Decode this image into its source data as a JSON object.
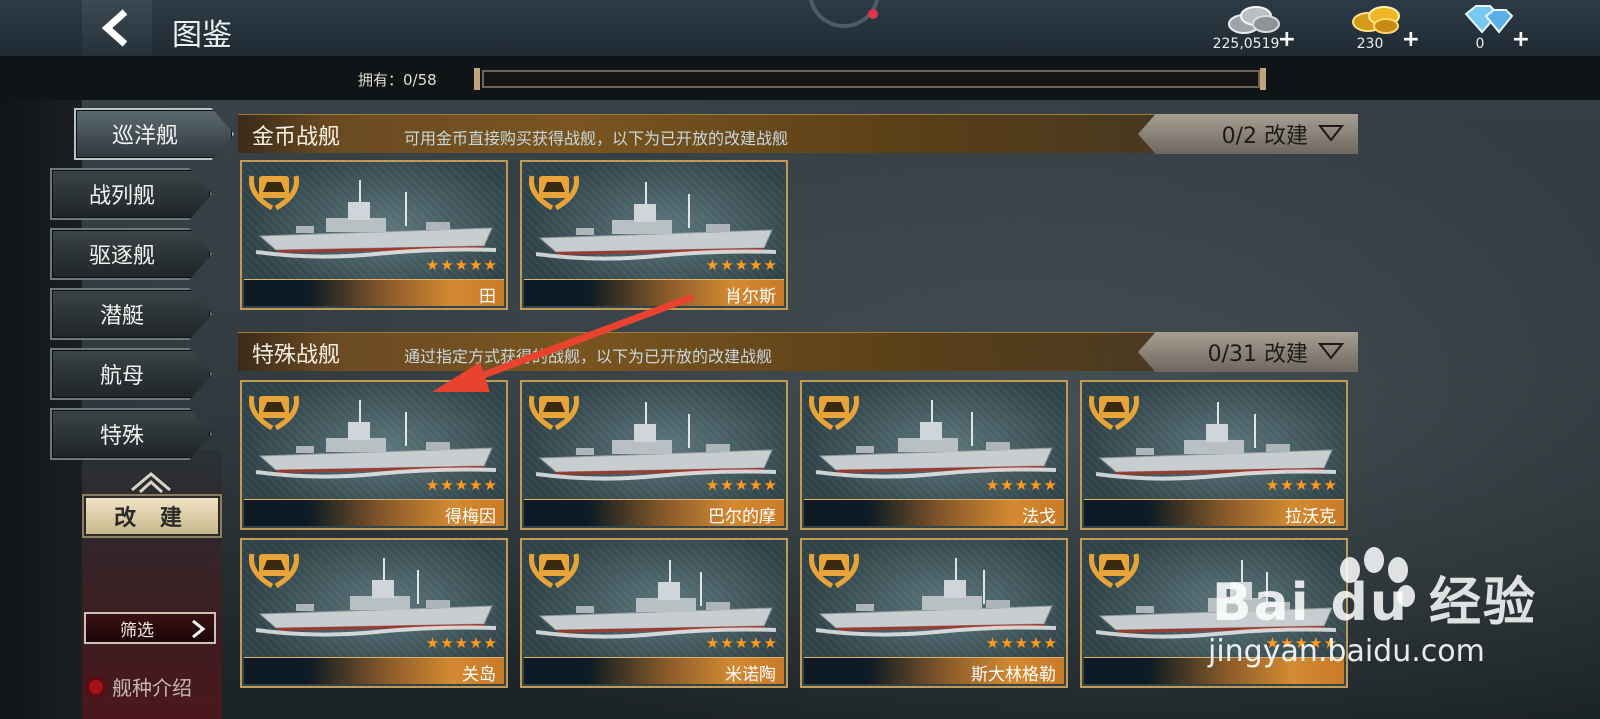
{
  "header": {
    "title": "图鉴",
    "silver": "225,0519",
    "gold": "230",
    "diamond": "0",
    "plus": "+"
  },
  "collection": {
    "label": "拥有：0/58",
    "progress": 0
  },
  "categories": [
    {
      "label": "巡洋舰",
      "active": true
    },
    {
      "label": "战列舰",
      "active": false
    },
    {
      "label": "驱逐舰",
      "active": false
    },
    {
      "label": "潜艇",
      "active": false
    },
    {
      "label": "航母",
      "active": false
    },
    {
      "label": "特殊",
      "active": false
    }
  ],
  "sidebar": {
    "rebuild": "改 建",
    "filter": "筛选",
    "type_intro": "舰种介绍"
  },
  "gold_section": {
    "title": "金币战舰",
    "desc": "可用金币直接购买获得战舰，以下为已开放的改建战舰",
    "count": "0/2 改建",
    "ships": [
      {
        "name": "田",
        "stars": "★★★★★"
      },
      {
        "name": "肖尔斯",
        "stars": "★★★★★"
      }
    ]
  },
  "special_section": {
    "title": "特殊战舰",
    "desc": "通过指定方式获得的战舰，以下为已开放的改建战舰",
    "count": "0/31 改建",
    "ships": [
      {
        "name": "得梅因",
        "stars": "★★★★★"
      },
      {
        "name": "巴尔的摩",
        "stars": "★★★★★"
      },
      {
        "name": "法戈",
        "stars": "★★★★★"
      },
      {
        "name": "拉沃克",
        "stars": "★★★★★"
      },
      {
        "name": "关岛",
        "stars": "★★★★★"
      },
      {
        "name": "米诺陶",
        "stars": "★★★★★"
      },
      {
        "name": "斯大林格勒",
        "stars": "★★★★★"
      },
      {
        "name": "",
        "stars": "★★★★★"
      }
    ]
  },
  "watermark": {
    "brand": "Bai du 经验",
    "url": "jingyan.baidu.com"
  },
  "colors": {
    "card_border": "#c39a55",
    "star": "#ff9a1c",
    "annotation_arrow": "#e8432e"
  }
}
